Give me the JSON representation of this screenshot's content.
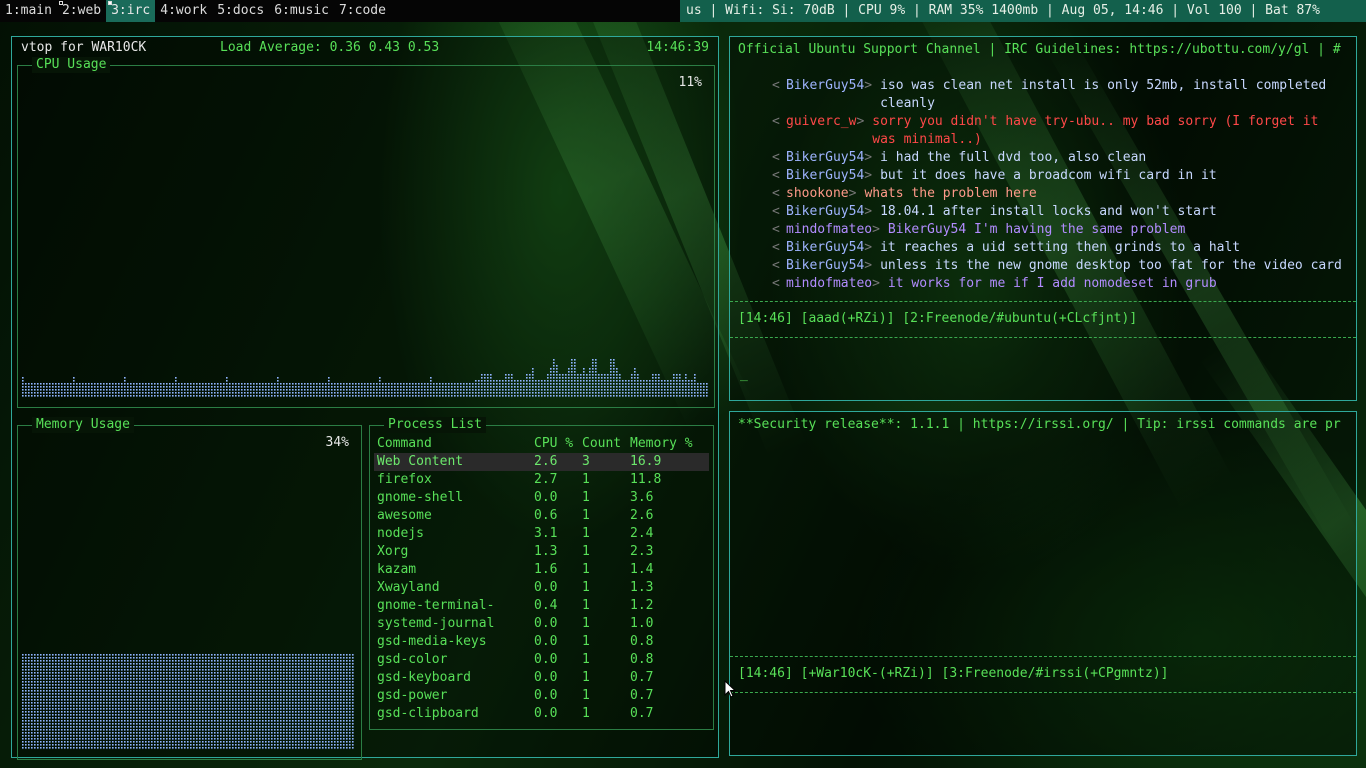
{
  "topbar": {
    "tags": [
      {
        "label": "1:main",
        "active": false,
        "has_client": false
      },
      {
        "label": "2:web",
        "active": false,
        "has_client": true
      },
      {
        "label": "3:irc",
        "active": true,
        "has_client": true
      },
      {
        "label": "4:work",
        "active": false,
        "has_client": false
      },
      {
        "label": "5:docs",
        "active": false,
        "has_client": false
      },
      {
        "label": "6:music",
        "active": false,
        "has_client": false
      },
      {
        "label": "7:code",
        "active": false,
        "has_client": false
      }
    ],
    "status": "us | Wifi: Si: 70dB | CPU 9% | RAM 35% 1400mb | Aug 05, 14:46 | Vol 100 | Bat 87%"
  },
  "vtop": {
    "title": "vtop for WAR10CK",
    "load": "Load Average: 0.36 0.43 0.53",
    "time": "14:46:39",
    "cpu": {
      "title": "CPU Usage",
      "percent": "11%"
    },
    "memory": {
      "title": "Memory Usage",
      "percent": "34%"
    },
    "processes": {
      "title": "Process List",
      "headers": [
        "Command",
        "CPU %",
        "Count",
        "Memory %"
      ],
      "rows": [
        [
          "Web Content",
          "2.6",
          "3",
          "16.9"
        ],
        [
          "firefox",
          "2.7",
          "1",
          "11.8"
        ],
        [
          "gnome-shell",
          "0.0",
          "1",
          "3.6"
        ],
        [
          "awesome",
          "0.6",
          "1",
          "2.6"
        ],
        [
          "nodejs",
          "3.1",
          "1",
          "2.4"
        ],
        [
          "Xorg",
          "1.3",
          "1",
          "2.3"
        ],
        [
          "kazam",
          "1.6",
          "1",
          "1.4"
        ],
        [
          "Xwayland",
          "0.0",
          "1",
          "1.3"
        ],
        [
          "gnome-terminal-",
          "0.4",
          "1",
          "1.2"
        ],
        [
          "systemd-journal",
          "0.0",
          "1",
          "1.0"
        ],
        [
          "gsd-media-keys",
          "0.0",
          "1",
          "0.8"
        ],
        [
          "gsd-color",
          "0.0",
          "1",
          "0.8"
        ],
        [
          "gsd-keyboard",
          "0.0",
          "1",
          "0.7"
        ],
        [
          "gsd-power",
          "0.0",
          "1",
          "0.7"
        ],
        [
          "gsd-clipboard",
          "0.0",
          "1",
          "0.7"
        ]
      ]
    }
  },
  "irc_ubuntu": {
    "topic": "Official Ubuntu Support Channel | IRC Guidelines: https://ubottu.com/y/gl | #",
    "messages": [
      {
        "nick": "BikerGuy54",
        "text": "iso was clean net install is only 52mb, install completed",
        "cont": "cleanly",
        "style": "blue"
      },
      {
        "nick": "guiverc_w",
        "text": "sorry you didn't have try-ubu.. my bad sorry (I forget it",
        "cont": "was minimal..)",
        "style": "red"
      },
      {
        "nick": "BikerGuy54",
        "text": "i had the full dvd too, also clean",
        "cont": "",
        "style": "blue"
      },
      {
        "nick": "BikerGuy54",
        "text": "but it does have a broadcom wifi card in it",
        "cont": "",
        "style": "blue"
      },
      {
        "nick": "shookone",
        "text": "whats the problem here",
        "cont": "",
        "style": "salmon"
      },
      {
        "nick": "BikerGuy54",
        "text": "18.04.1 after install locks and won't start",
        "cont": "",
        "style": "blue"
      },
      {
        "nick": "mindofmateo",
        "text": "BikerGuy54 I'm having the same problem",
        "cont": "",
        "style": "violet"
      },
      {
        "nick": "BikerGuy54",
        "text": "it reaches a uid setting then grinds to a halt",
        "cont": "",
        "style": "blue"
      },
      {
        "nick": "BikerGuy54",
        "text": "unless its the new gnome desktop too fat for the video card",
        "cont": "",
        "style": "blue"
      },
      {
        "nick": "mindofmateo",
        "text": "it works for me if I add nomodeset in grub",
        "cont": "",
        "style": "violet"
      }
    ],
    "statusline": "[14:46] [aaad(+RZi)] [2:Freenode/#ubuntu(+CLcfjnt)]",
    "input": "_"
  },
  "irc_irssi": {
    "topic": "**Security release**: 1.1.1 | https://irssi.org/ | Tip: irssi commands are pr",
    "statusline": "[14:46] [+War10cK-(+RZi)] [3:Freenode/#irssi(+CPgmntz)]"
  },
  "colors": {
    "accent_green": "#58e058",
    "border_teal": "#2fa89b",
    "status_bg": "#13604c"
  }
}
